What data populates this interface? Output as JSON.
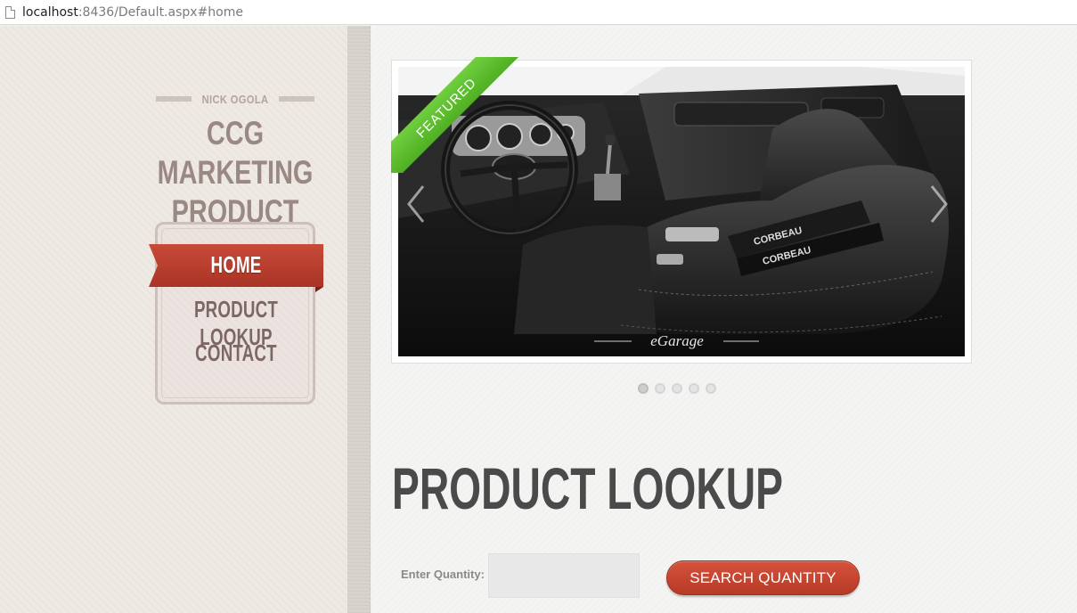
{
  "browser": {
    "url_host": "localhost",
    "url_rest": ":8436/Default.aspx#home"
  },
  "sidebar": {
    "author": "NICK OGOLA",
    "title_line1": "CCG MARKETING",
    "title_line2": "PRODUCT DEMO",
    "nav": [
      {
        "label": "HOME",
        "active": true
      },
      {
        "label": "PRODUCT LOOKUP",
        "active": false
      },
      {
        "label": "CONTACT",
        "active": false
      }
    ]
  },
  "slider": {
    "badge": "FEATURED",
    "image_watermark": "eGarage",
    "dot_count": 5,
    "active_dot": 1,
    "icons": {
      "prev": "chevron-left-icon",
      "next": "chevron-right-icon"
    },
    "badge_color": "#5cbf2a"
  },
  "lookup": {
    "heading": "PRODUCT LOOKUP",
    "quantity_label": "Enter Quantity:",
    "quantity_value": "",
    "search_button": "SEARCH QUANTITY"
  },
  "colors": {
    "accent_red": "#c44330",
    "heading_gray": "#4a4a4a",
    "sidebar_text": "#9a8884"
  }
}
